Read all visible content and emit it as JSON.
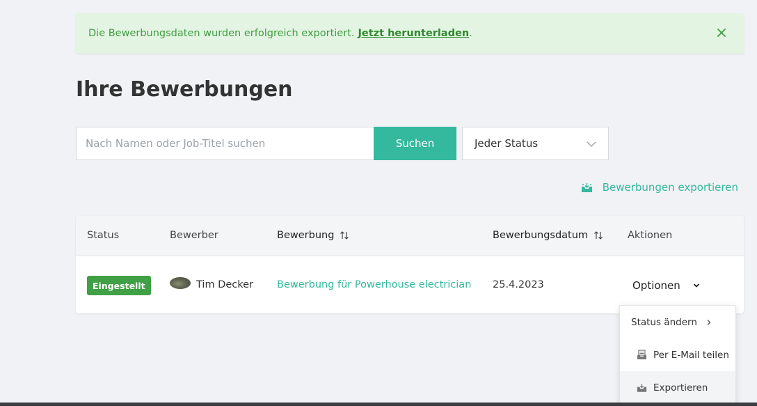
{
  "alert": {
    "message": "Die Bewerbungsdaten wurden erfolgreich exportiert.",
    "link_label": "Jetzt herunterladen",
    "suffix": ".",
    "close_icon": "close-icon"
  },
  "page": {
    "title": "Ihre Bewerbungen"
  },
  "search": {
    "placeholder": "Nach Namen oder Job-Titel suchen",
    "value": "",
    "button_label": "Suchen"
  },
  "status_filter": {
    "selected": "Jeder Status"
  },
  "export": {
    "label": "Bewerbungen exportieren",
    "icon": "export-tray-icon"
  },
  "table": {
    "headers": {
      "status": "Status",
      "applicant": "Bewerber",
      "application": "Bewerbung",
      "date": "Bewerbungsdatum",
      "actions": "Aktionen"
    },
    "rows": [
      {
        "status": "Eingestellt",
        "applicant": "Tim Decker",
        "application": "Bewerbung für Powerhouse electrician",
        "date": "25.4.2023",
        "action_label": "Optionen"
      }
    ]
  },
  "actions_menu": {
    "items": [
      {
        "label": "Status ändern",
        "icon": "chevron-right-icon"
      },
      {
        "label": "Per E-Mail teilen",
        "icon": "mail-tray-icon"
      },
      {
        "label": "Exportieren",
        "icon": "export-tray-icon"
      }
    ]
  },
  "colors": {
    "accent": "#34b89e",
    "success_badge": "#3fa046",
    "alert_bg": "#e3f4e3",
    "alert_text": "#3f9e3f"
  }
}
